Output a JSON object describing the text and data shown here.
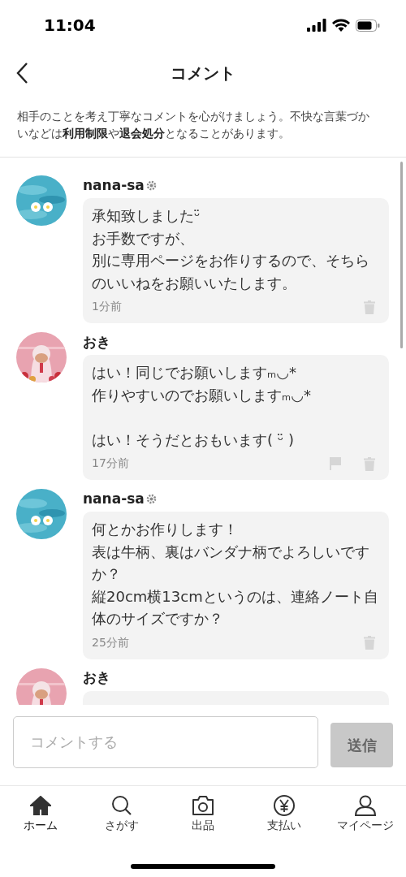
{
  "status_bar": {
    "time": "11:04"
  },
  "header": {
    "title": "コメント"
  },
  "notice": "相手のことを考え丁寧なコメントを心がけましょう。不快な言葉づかいなどは**利用制限**や**退会処分**となることがあります。",
  "comments": [
    {
      "user": "nana-sa",
      "verified": true,
      "avatar": {
        "kind": "picture",
        "color": "#49b0c8"
      },
      "paragraphs": [
        [
          "承知致しましたᵕ̈",
          "お手数ですが、",
          "別に専用ページをお作りするので、そちらのいいねをお願いいたします。"
        ]
      ],
      "time": "1分前",
      "actions": [
        {
          "kind": "delete"
        }
      ]
    },
    {
      "user": "おき",
      "verified": false,
      "avatar": {
        "kind": "picture",
        "color": "#e8a3b0"
      },
      "paragraphs": [
        [
          "はい！同じでお願いしますₘ◡*",
          "作りやすいのでお願いしますₘ◡*"
        ],
        [
          "はい！そうだとおもいます( ᵕ̈ )"
        ]
      ],
      "time": "17分前",
      "actions": [
        {
          "kind": "report"
        },
        {
          "kind": "delete"
        }
      ]
    },
    {
      "user": "nana-sa",
      "verified": true,
      "avatar": {
        "kind": "picture",
        "color": "#49b0c8"
      },
      "paragraphs": [
        [
          "何とかお作りします！",
          "表は牛柄、裏はバンダナ柄でよろしいですか？",
          "縦20cm横13cmというのは、連絡ノート自体のサイズですか？"
        ]
      ],
      "time": "25分前",
      "actions": [
        {
          "kind": "delete"
        }
      ]
    },
    {
      "user": "おき",
      "verified": false,
      "avatar": {
        "kind": "picture",
        "color": "#e8a3b0"
      }
    }
  ],
  "comment_box": {
    "placeholder": "コメントする"
  },
  "send_button": {
    "label": "送信",
    "disabled": true
  },
  "tabs": [
    {
      "kind": "home",
      "label": "ホーム",
      "selected": true
    },
    {
      "kind": "search",
      "label": "さがす",
      "selected": false
    },
    {
      "kind": "camera",
      "label": "出品",
      "selected": false
    },
    {
      "kind": "yen",
      "label": "支払い",
      "selected": false
    },
    {
      "kind": "person",
      "label": "マイページ",
      "selected": false
    }
  ]
}
